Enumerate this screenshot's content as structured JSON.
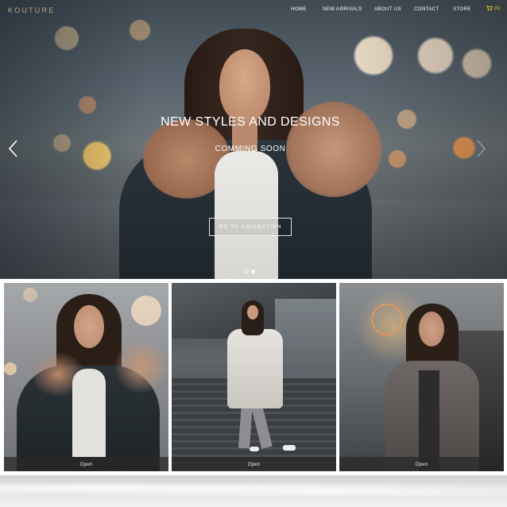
{
  "brand": {
    "logo_text": "KOUTURE"
  },
  "nav": {
    "items": [
      {
        "label": "HOME"
      },
      {
        "label": "NEW ARRIVALS"
      },
      {
        "label": "ABOUT US"
      },
      {
        "label": "CONTACT"
      },
      {
        "label": "STORE"
      }
    ],
    "cart": {
      "icon": "cart-icon",
      "count_label": "(0)",
      "color": "#e3b537"
    }
  },
  "hero": {
    "title": "NEW STYLES AND DESIGNS",
    "subtitle": "COMMING SOON",
    "cta_label": "GO TO COLLECTION",
    "prev_icon": "chevron-left-icon",
    "next_icon": "chevron-right-icon",
    "slides_total": 2,
    "active_slide": 2
  },
  "tiles": [
    {
      "image": "model-fur-jacket-photo",
      "open_label": "Open"
    },
    {
      "image": "model-white-coat-stairs-photo",
      "open_label": "Open"
    },
    {
      "image": "model-sunset-jacket-photo",
      "open_label": "Open"
    }
  ]
}
